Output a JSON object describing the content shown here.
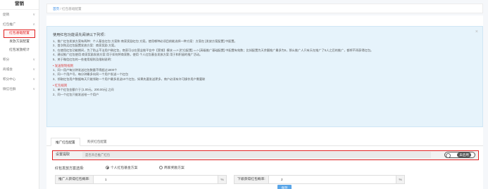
{
  "sidebar": {
    "brand": "营销",
    "items": [
      {
        "label": "促销",
        "arrow": "∨"
      },
      {
        "label": "红包推广",
        "arrow": "∧"
      }
    ],
    "sub_items": [
      {
        "label": "红包基础配置"
      },
      {
        "label": "发放方案配置"
      },
      {
        "label": "红包发放统计"
      }
    ],
    "items2": [
      {
        "label": "积分",
        "arrow": "∨"
      },
      {
        "label": "商城会",
        "arrow": "∨"
      },
      {
        "label": "积分中心",
        "arrow": "∨"
      },
      {
        "label": "微信社群",
        "arrow": "∨"
      }
    ]
  },
  "breadcrumb": {
    "home": "首页",
    "sep": "/",
    "current": "红包基础配置"
  },
  "notice": {
    "close": "×",
    "title": "使用红包功能请先阅读以下列项：",
    "lines": [
      "1、推广红包发放方案有两种：个人基金红包 方案和 商家奖励红包 方案。使用哪种必须目前能选择一种方案：方案在 [发放方案配置] 中配置。",
      "2、首次购买红包配置发放方案：商家奖励 方案。",
      "3、在使用红包功能期间，为了防止不法用户刷红包，商家可以在营业推平台中【营销】模块 ==> [栏位配置] ==> [高级推广基础配置] 中配置有效数；比如配置为天余额推广最多为5，那么推广人只有天在推广了5人之后的推广，都将不再获得红包。",
      "4、建议推广红包使用 商家奖励发放方案 用于如何将商家数，使用 个人红包基金发放方案 用于和积留的推广活动。",
      "5、关于微信红包的一些使用规则及限制说明："
    ],
    "sec1": "• 发送限制规则",
    "lines2": [
      "1、同一用户每分钟发送红包数量不得超过1800个",
      "2、同一个用户号，每分钟最多向同一个用户发送一个红包",
      "3、领取红包用户数据每天只能领取一个用户最多发送10个红包，如果先要发送更多，商户必须有许可操作用户需要联"
    ],
    "sec2": "• 红包规则",
    "lines3": [
      "1、单个红包金额介于 [1.00元，200.00元] 之间",
      "2、同一个红包只能发送给一个用户"
    ]
  },
  "tabs": [
    {
      "label": "推广红包配置"
    },
    {
      "label": "购买红包配置"
    }
  ],
  "settings": {
    "label": "设置提取",
    "value": "是否开启推广红包",
    "toggle_text": "未启用"
  },
  "scheme": {
    "label": "红包发放方案选择:",
    "options": [
      {
        "label": "个人红包基金方案",
        "checked": true
      },
      {
        "label": "商家奖励方案",
        "checked": false
      }
    ]
  },
  "fields": {
    "promoter": {
      "label": "推广人获得红包概率:",
      "value": "1",
      "unit": "%"
    },
    "downline": {
      "label": "下级获得红包概率:",
      "value": "2",
      "unit": "%"
    }
  },
  "save_label": "保存"
}
